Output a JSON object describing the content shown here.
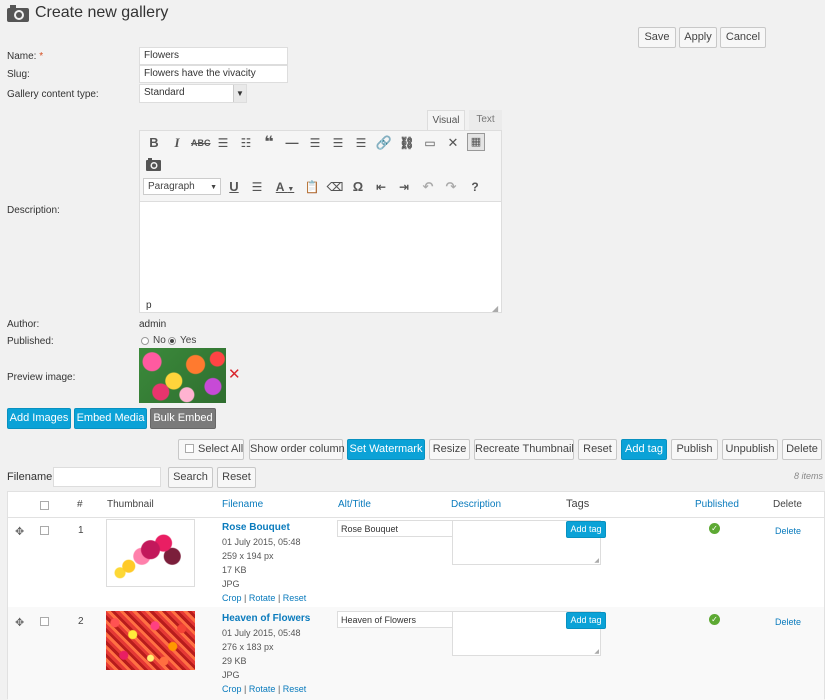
{
  "header": {
    "title": "Create new gallery",
    "icon": "camera-icon"
  },
  "top_actions": {
    "save": "Save",
    "apply": "Apply",
    "cancel": "Cancel"
  },
  "form": {
    "name_label": "Name:",
    "required_mark": "*",
    "name_value": "Flowers",
    "slug_label": "Slug:",
    "slug_value": "Flowers have the vivacity",
    "type_label": "Gallery content type:",
    "type_value": "Standard",
    "description_label": "Description:",
    "author_label": "Author:",
    "author_value": "admin",
    "published_label": "Published:",
    "published_no": "No",
    "published_yes": "Yes",
    "published_selected": "Yes",
    "preview_label": "Preview image:"
  },
  "editor": {
    "tab_visual": "Visual",
    "tab_text": "Text",
    "active_tab": "Visual",
    "format_select": "Paragraph",
    "path": "p",
    "toolbar_row1": [
      "bold-icon",
      "italic-icon",
      "strikethrough-icon",
      "bullet-list-icon",
      "numbered-list-icon",
      "blockquote-icon",
      "horizontal-rule-icon",
      "align-left-icon",
      "align-center-icon",
      "align-right-icon",
      "link-icon",
      "unlink-icon",
      "read-more-icon",
      "fullscreen-icon",
      "toolbar-toggle-icon"
    ],
    "toolbar_row3": [
      "underline-icon",
      "justify-icon",
      "text-color-icon",
      "paste-text-icon",
      "clear-formatting-icon",
      "special-character-icon",
      "outdent-icon",
      "indent-icon",
      "undo-icon",
      "redo-icon",
      "help-icon"
    ]
  },
  "media_actions": {
    "add_images": "Add Images",
    "embed_media": "Embed Media",
    "bulk_embed": "Bulk Embed"
  },
  "bulk_actions": {
    "select_all": "Select All",
    "show_order": "Show order column",
    "set_watermark": "Set Watermark",
    "resize": "Resize",
    "recreate": "Recreate Thumbnail",
    "reset": "Reset",
    "add_tag": "Add tag",
    "publish": "Publish",
    "unpublish": "Unpublish",
    "delete": "Delete"
  },
  "filter": {
    "label": "Filename:",
    "value": "",
    "search": "Search",
    "reset": "Reset",
    "count": "8 items"
  },
  "table": {
    "columns": {
      "num": "#",
      "thumbnail": "Thumbnail",
      "filename": "Filename",
      "alt": "Alt/Title",
      "description": "Description",
      "tags": "Tags",
      "published": "Published",
      "delete": "Delete"
    },
    "rows": [
      {
        "num": "1",
        "filename": "Rose Bouquet",
        "date": "01 July 2015, 05:48",
        "dims": "259 x 194 px",
        "size": "17 KB",
        "format": "JPG",
        "crop": "Crop",
        "rotate": "Rotate",
        "reset": "Reset",
        "sep": "|",
        "alt": "Rose Bouquet",
        "add_tag": "Add tag",
        "delete": "Delete"
      },
      {
        "num": "2",
        "filename": "Heaven of Flowers",
        "date": "01 July 2015, 05:48",
        "dims": "276 x 183 px",
        "size": "29 KB",
        "format": "JPG",
        "crop": "Crop",
        "rotate": "Rotate",
        "reset": "Reset",
        "sep": "|",
        "alt": "Heaven of Flowers",
        "add_tag": "Add tag",
        "delete": "Delete"
      }
    ]
  },
  "colors": {
    "accent": "#0ba2d7",
    "link": "#0a7bbd",
    "required": "#d54e21",
    "published": "#5da933",
    "remove": "#d9272e"
  }
}
